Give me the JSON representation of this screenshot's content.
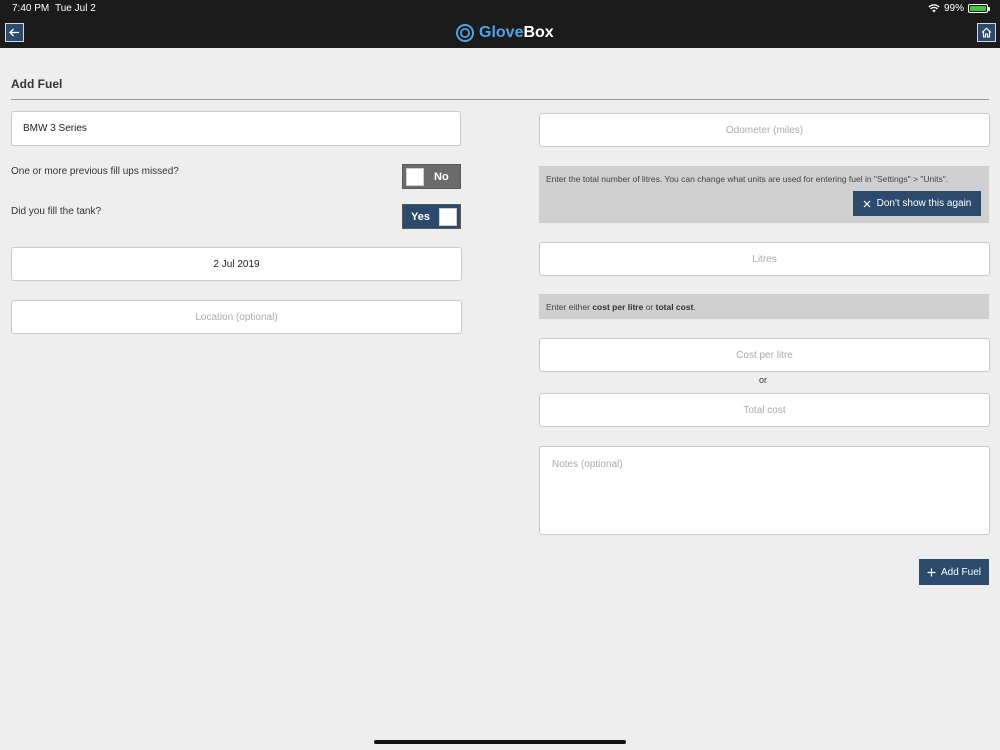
{
  "status": {
    "time": "7:40 PM",
    "date": "Tue Jul 2",
    "battery": "99%"
  },
  "app": {
    "name_part1": "Glove",
    "name_part2": "Box"
  },
  "page": {
    "title": "Add Fuel"
  },
  "form": {
    "vehicle": "BMW 3 Series",
    "missed_question": "One or more previous fill ups missed?",
    "missed_toggle": "No",
    "filled_question": "Did you fill the tank?",
    "filled_toggle": "Yes",
    "date": "2 Jul 2019",
    "location_placeholder": "Location (optional)",
    "odometer_placeholder": "Odometer (miles)",
    "litres_info": "Enter the total number of litres. You can change what units are used for entering fuel in \"Settings\" > \"Units\".",
    "dismiss_label": "Don't show this again",
    "litres_placeholder": "Litres",
    "cost_info_prefix": "Enter either ",
    "cost_info_bold1": "cost per litre",
    "cost_info_mid": " or ",
    "cost_info_bold2": "total cost",
    "cost_info_suffix": ".",
    "cost_per_litre_placeholder": "Cost per litre",
    "or_label": "or",
    "total_cost_placeholder": "Total cost",
    "notes_placeholder": "Notes (optional)",
    "add_button": "Add Fuel"
  },
  "colors": {
    "accent": "#2c4a6b",
    "logo_blue": "#4fa3e8",
    "bar": "#1b1b1b"
  },
  "icons": {
    "back": "arrow-left-icon",
    "home": "home-icon",
    "dismiss": "close-icon",
    "add": "plus-icon",
    "wifi": "wifi-icon",
    "battery": "battery-icon"
  }
}
